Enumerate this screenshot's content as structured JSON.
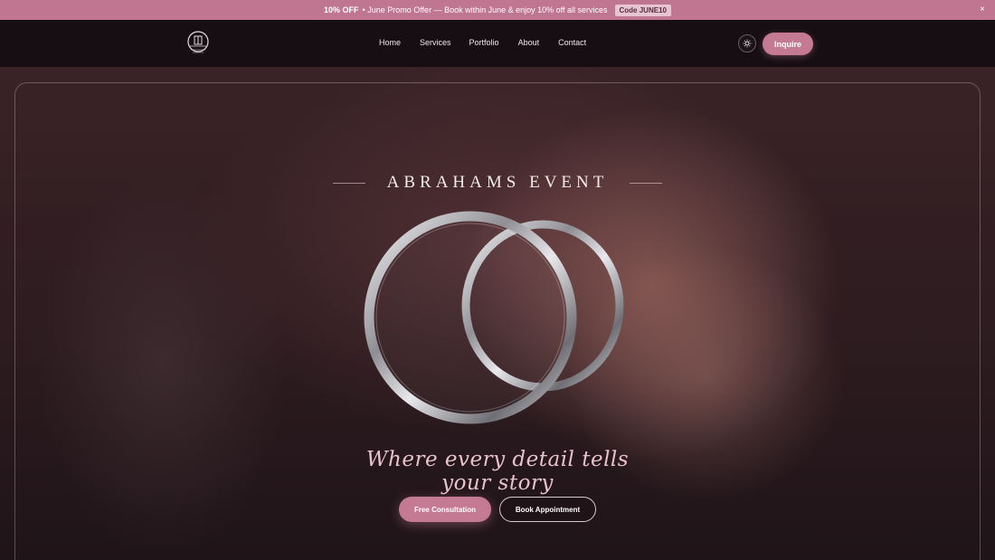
{
  "promo": {
    "bold": "10% OFF",
    "text": "• June Promo Offer — Book within June & enjoy 10% off all services",
    "code": "Code JUNE10",
    "close": "×"
  },
  "nav": {
    "links": [
      "Home",
      "Services",
      "Portfolio",
      "About",
      "Contact"
    ],
    "inquire": "Inquire"
  },
  "hero": {
    "title": "ABRAHAMS EVENT",
    "tagline": "Where every detail tells your story",
    "primary_button": "Free Consultation",
    "secondary_button": "Book Appointment"
  },
  "colors": {
    "accent": "#c57a94",
    "promo_bg": "#c07590",
    "nav_bg": "#160e12"
  },
  "icons": {
    "theme": "sun-icon",
    "logo": "logo-icon",
    "close": "close-icon"
  }
}
